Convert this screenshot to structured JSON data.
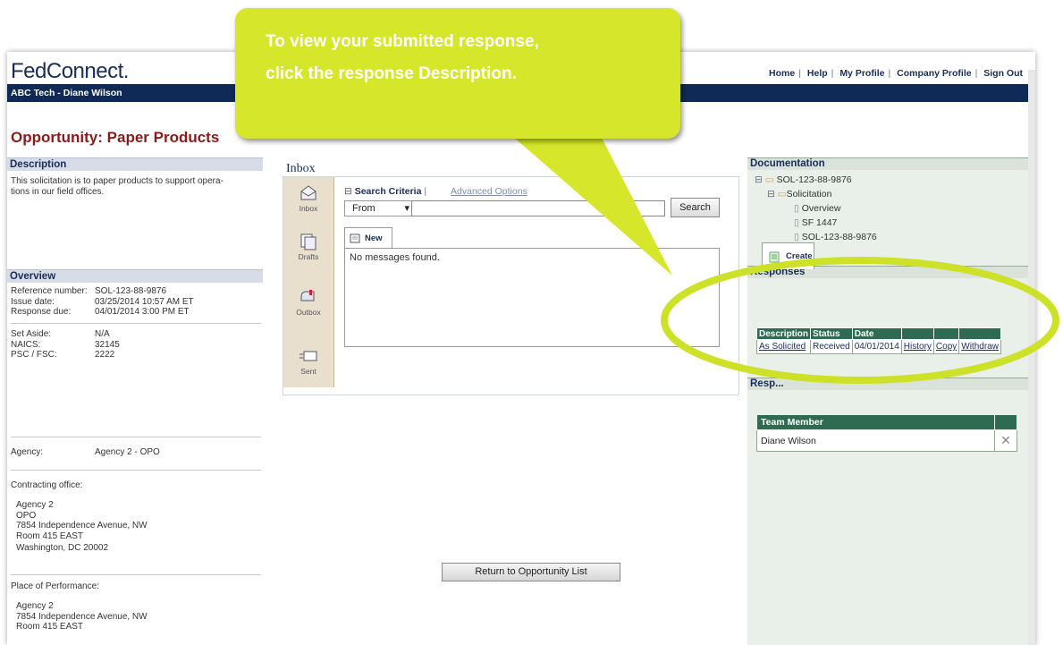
{
  "header": {
    "logo": "FedConnect.",
    "links": [
      "Home",
      "Help",
      "My Profile",
      "Company Profile",
      "Sign Out"
    ],
    "user": "ABC Tech - Diane Wilson"
  },
  "page_title": "Opportunity:  Paper Products",
  "description": {
    "heading": "Description",
    "text_line1": "This solicitation is to paper products to support opera-",
    "text_line2": "tions in our field offices."
  },
  "overview": {
    "heading": "Overview",
    "rows": [
      {
        "k": "Reference number:",
        "v": "SOL-123-88-9876"
      },
      {
        "k": "Issue date:",
        "v": "03/25/2014  10:57 AM  ET"
      },
      {
        "k": "Response due:",
        "v": "04/01/2014 3:00 PM  ET"
      }
    ],
    "rows2": [
      {
        "k": "Set Aside:",
        "v": "N/A"
      },
      {
        "k": "NAICS:",
        "v": "32145"
      },
      {
        "k": "PSC / FSC:",
        "v": "2222"
      }
    ],
    "agency_label": "Agency:",
    "agency_value": "Agency 2 - OPO",
    "contracting_label": "Contracting office:",
    "contracting_lines": [
      "Agency 2",
      "OPO",
      "7854 Independence Avenue, NW",
      "Room 415 EAST",
      "Washington, DC 20002"
    ],
    "place_label": "Place of Performance:",
    "place_lines": [
      "Agency 2",
      "7854 Independence Avenue, NW",
      "Room 415 EAST"
    ]
  },
  "inbox": {
    "title": "Inbox",
    "side": [
      "Inbox",
      "Drafts",
      "Outbox",
      "Sent"
    ],
    "search_criteria": "Search Criteria",
    "advanced": "Advanced Options",
    "from": "From",
    "search_btn": "Search",
    "new_tab": "New",
    "empty": "No messages found."
  },
  "return_btn": "Return to Opportunity List",
  "documentation": {
    "heading": "Documentation",
    "items": [
      "SOL-123-88-9876",
      "Solicitation",
      "Overview",
      "SF 1447",
      "SOL-123-88-9876"
    ]
  },
  "responses": {
    "heading": "Responses",
    "create": "Create",
    "columns": [
      "Description",
      "Status",
      "Date",
      "",
      "",
      ""
    ],
    "row": [
      "As Solicited",
      "Received",
      "04/01/2014",
      "History",
      "Copy",
      "Withdraw"
    ]
  },
  "team": {
    "heading": "Resp...",
    "column": "Team Member",
    "member": "Diane Wilson"
  },
  "callout": {
    "line1": "To view your submitted response,",
    "line2": "click the response Description."
  },
  "colors": {
    "accent": "#0f2a56",
    "title": "#8b1a1a",
    "callout": "#d5e62b",
    "highlight_ellipse": "#cde128"
  }
}
